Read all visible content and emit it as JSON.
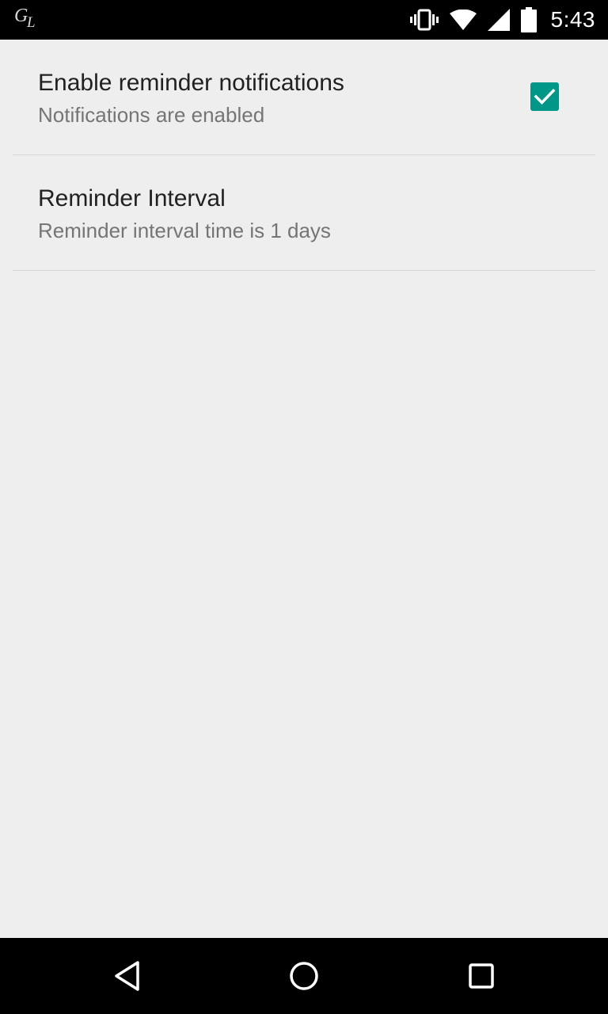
{
  "status_bar": {
    "time": "5:43",
    "icons": [
      "gl-notification-icon",
      "vibrate-icon",
      "wifi-icon",
      "cell-signal-icon",
      "battery-icon"
    ]
  },
  "preferences": {
    "items": [
      {
        "title": "Enable reminder notifications",
        "summary": "Notifications are enabled",
        "checked": true
      },
      {
        "title": "Reminder Interval",
        "summary": "Reminder interval time is 1 days"
      }
    ]
  },
  "colors": {
    "accent": "#009688",
    "background": "#eeeeee",
    "title_text": "#212121",
    "summary_text": "#757575"
  },
  "nav_bar": {
    "buttons": [
      "back-icon",
      "home-icon",
      "recents-icon"
    ]
  }
}
